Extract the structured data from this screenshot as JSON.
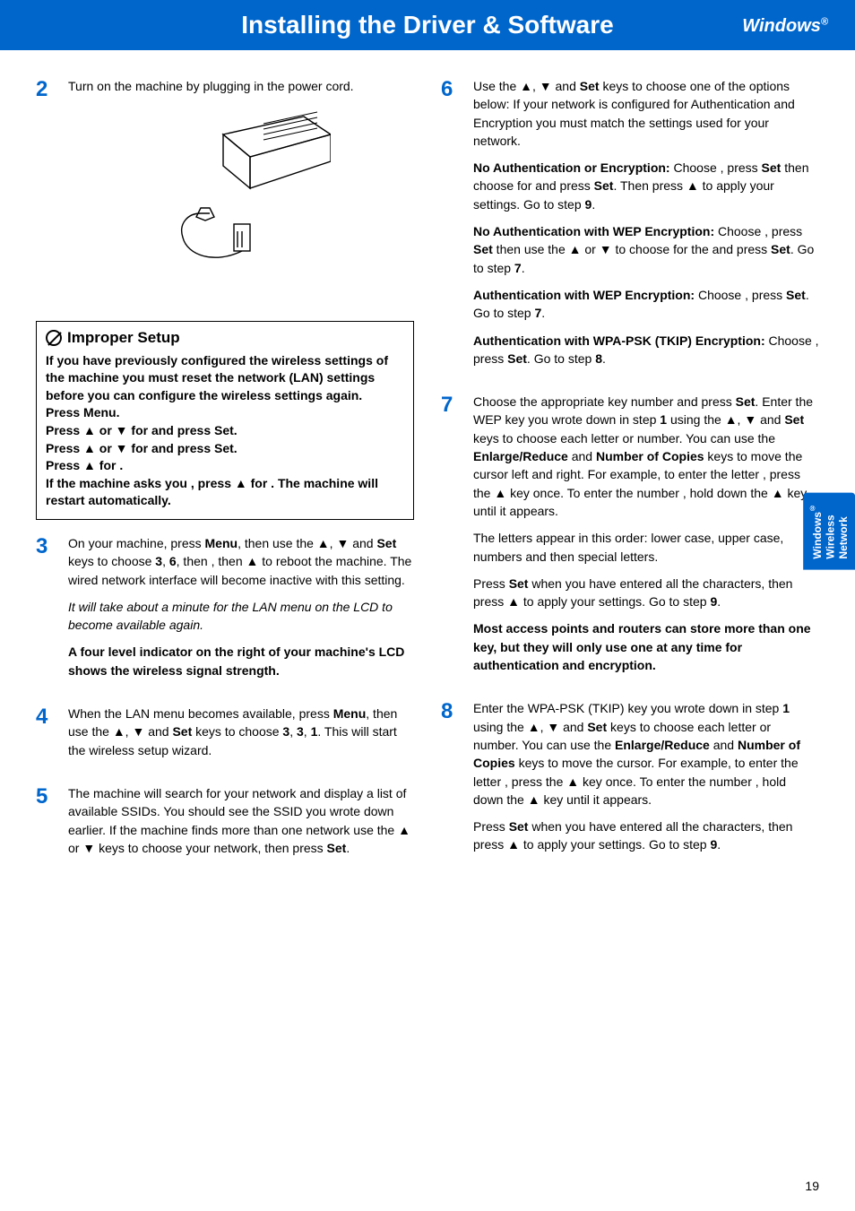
{
  "header": {
    "title": "Installing the Driver & Software",
    "os": "Windows",
    "os_reg": "®"
  },
  "sidetab": {
    "line1": "Windows",
    "reg": "®",
    "line2": "Wireless",
    "line3": "Network"
  },
  "left": {
    "step2": {
      "num": "2",
      "text": "Turn on the machine by plugging in the power cord."
    },
    "improper": {
      "heading": "Improper Setup",
      "body1": "If you have previously configured the wireless settings of the machine you must reset the network (LAN) settings before you can configure the wireless settings again.",
      "body2": "Press Menu.",
      "body3a": "Press ▲ or ▼ for ",
      "body3b": " and press Set.",
      "body4a": "Press ▲ or ▼ for ",
      "body4b": " and press Set.",
      "body5": "Press ▲ for ",
      "body5b": ".",
      "body6a": "If the machine asks you ",
      "body6b": ", press ▲ for ",
      "body6c": ". The machine will restart automatically."
    },
    "step3": {
      "num": "3",
      "p1a": "On your machine, press ",
      "p1_menu": "Menu",
      "p1b": ", then use the ▲, ▼ and ",
      "p1_set": "Set",
      "p1c": " keys to choose ",
      "p1_3": "3",
      "p1d": ", ",
      "p1_6": "6",
      "p1e": ", then ",
      "p1f": ", then ▲ ",
      "p1g": " to reboot the machine. The wired network interface will become inactive with this setting.",
      "p2": "It will take about a minute for the LAN menu on the LCD to become available again.",
      "p3": "A four level indicator on the right of your machine's LCD shows the wireless signal strength."
    },
    "step4": {
      "num": "4",
      "p1a": "When the LAN menu becomes available, press ",
      "p1_menu": "Menu",
      "p1b": ", then use the ▲, ▼ and ",
      "p1_set": "Set",
      "p1c": " keys to choose ",
      "p1_3a": "3",
      "p1d": ", ",
      "p1_3b": "3",
      "p1e": ", ",
      "p1_1": "1",
      "p1f": ". This will start the wireless setup wizard."
    },
    "step5": {
      "num": "5",
      "p1a": "The machine will search for your network and display a list of available SSIDs. You should see the SSID you wrote down earlier. If the machine finds more than one network use the ▲ or ▼ keys to choose your network, then press ",
      "p1_set": "Set",
      "p1b": "."
    }
  },
  "right": {
    "step6": {
      "num": "6",
      "p1a": "Use the ▲, ▼ and ",
      "p1_set": "Set",
      "p1b": " keys to choose one of the options below: If your network is configured for Authentication and Encryption you must match the settings used for your network.",
      "noauth_head": "No Authentication or Encryption:",
      "noauth_a": " Choose ",
      "noauth_b": ", press ",
      "noauth_set1": "Set",
      "noauth_c": " then choose ",
      "noauth_d": " for ",
      "noauth_e": " and press ",
      "noauth_set2": "Set",
      "noauth_f": ". Then press ▲ ",
      "noauth_g": " to apply your settings. Go to step ",
      "noauth_9": "9",
      "noauth_h": ".",
      "wep1_head": "No Authentication with WEP Encryption:",
      "wep1_a": " Choose ",
      "wep1_b": ", press ",
      "wep1_set": "Set",
      "wep1_c": " then use the ▲ or ▼ to choose ",
      "wep1_d": " for the ",
      "wep1_e": " and press ",
      "wep1_set2": "Set",
      "wep1_f": ". Go to step ",
      "wep1_7": "7",
      "wep1_g": ".",
      "wep2_head": "Authentication with WEP Encryption:",
      "wep2_a": " Choose ",
      "wep2_b": ", press ",
      "wep2_set": "Set",
      "wep2_c": ". Go to step ",
      "wep2_7": "7",
      "wep2_d": ".",
      "wpa_head": "Authentication with WPA-PSK (TKIP) Encryption:",
      "wpa_a": " Choose ",
      "wpa_b": ", press ",
      "wpa_set": "Set",
      "wpa_c": ". Go to step ",
      "wpa_8": "8",
      "wpa_d": "."
    },
    "step7": {
      "num": "7",
      "p1a": "Choose the appropriate key number and press ",
      "p1_set": "Set",
      "p1b": ". Enter the WEP key you wrote down in step ",
      "p1_1": "1",
      "p1c": " using the ▲, ▼ and ",
      "p1_set2": "Set",
      "p1d": " keys to choose each letter or number. You can use the ",
      "p1_er": "Enlarge/Reduce",
      "p1e": " and ",
      "p1_nc": "Number of Copies",
      "p1f": " keys to move the cursor left and right. For example, to enter the letter ",
      "p1g": ", press the ▲ key once. To enter the number ",
      "p1h": ", hold down the ▲ key until it appears.",
      "p2": "The letters appear in this order: lower case, upper case, numbers and then special letters.",
      "p3a": "Press ",
      "p3_set": "Set",
      "p3b": " when you have entered all the characters, then press ▲ ",
      "p3c": " to apply your settings. Go to step ",
      "p3_9": "9",
      "p3d": ".",
      "note": "Most access points and routers can store more than one key, but they will only use one at any time for authentication and encryption."
    },
    "step8": {
      "num": "8",
      "p1a": "Enter the WPA-PSK (TKIP) key ",
      "p1b": " you wrote down in step ",
      "p1_1": "1",
      "p1c": " using the ▲, ▼ and ",
      "p1_set": "Set",
      "p1d": " keys to choose each letter or number. You can use the ",
      "p1_er": "Enlarge/Reduce",
      "p1e": " and ",
      "p1_nc": "Number of Copies",
      "p1f": " keys to move the cursor. For example, to enter the letter ",
      "p1g": ", press the  ▲ key once. To enter the number ",
      "p1h": ", hold down the ▲ key until it appears.",
      "p2a": "Press ",
      "p2_set": "Set",
      "p2b": " when you have entered all the characters, then press ▲ ",
      "p2c": " to apply your settings. Go to step ",
      "p2_9": "9",
      "p2d": "."
    }
  },
  "page_number": "19"
}
